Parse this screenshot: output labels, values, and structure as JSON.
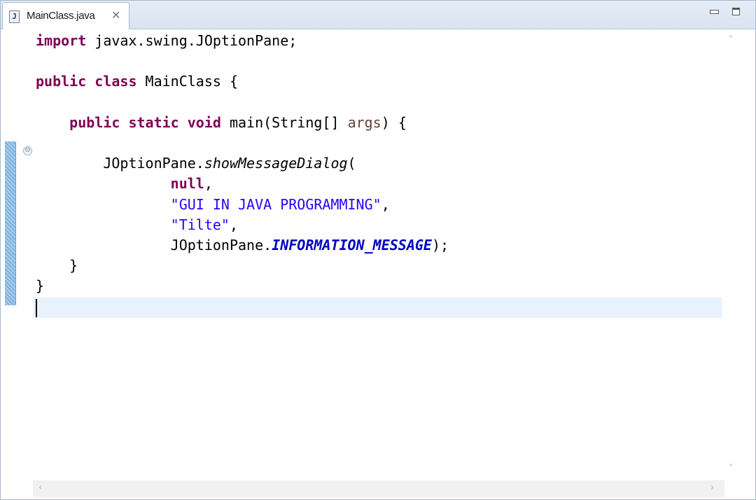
{
  "tab": {
    "icon": "java-file-icon",
    "icon_glyph": "J",
    "title": "MainClass.java",
    "close_glyph": "✕"
  },
  "window_controls": {
    "minimize_icon": "minimize-icon",
    "maximize_icon": "maximize-icon"
  },
  "gutter": {
    "fold_glyph": "⊖"
  },
  "code_lines": [
    [
      {
        "t": "import",
        "c": "kw"
      },
      {
        "t": " javax.swing.JOptionPane;"
      }
    ],
    [],
    [
      {
        "t": "public",
        "c": "kw"
      },
      {
        "t": " "
      },
      {
        "t": "class",
        "c": "kw"
      },
      {
        "t": " MainClass {"
      }
    ],
    [],
    [
      {
        "t": "    "
      },
      {
        "t": "public",
        "c": "kw"
      },
      {
        "t": " "
      },
      {
        "t": "static",
        "c": "kw"
      },
      {
        "t": " "
      },
      {
        "t": "void",
        "c": "kw"
      },
      {
        "t": " main(String[] "
      },
      {
        "t": "args",
        "c": "param"
      },
      {
        "t": ") {"
      }
    ],
    [],
    [
      {
        "t": "        JOptionPane."
      },
      {
        "t": "showMessageDialog",
        "c": "static-method"
      },
      {
        "t": "("
      }
    ],
    [
      {
        "t": "                "
      },
      {
        "t": "null",
        "c": "kw"
      },
      {
        "t": ","
      }
    ],
    [
      {
        "t": "                "
      },
      {
        "t": "\"GUI IN JAVA PROGRAMMING\"",
        "c": "str"
      },
      {
        "t": ","
      }
    ],
    [
      {
        "t": "                "
      },
      {
        "t": "\"Tilte\"",
        "c": "str"
      },
      {
        "t": ","
      }
    ],
    [
      {
        "t": "                JOptionPane."
      },
      {
        "t": "INFORMATION_MESSAGE",
        "c": "static-field"
      },
      {
        "t": ");"
      }
    ],
    [
      {
        "t": "    }"
      }
    ],
    [
      {
        "t": "}"
      }
    ],
    []
  ],
  "scroll": {
    "up_glyph": "˄",
    "down_glyph": "˅",
    "left_glyph": "‹",
    "right_glyph": "›"
  }
}
